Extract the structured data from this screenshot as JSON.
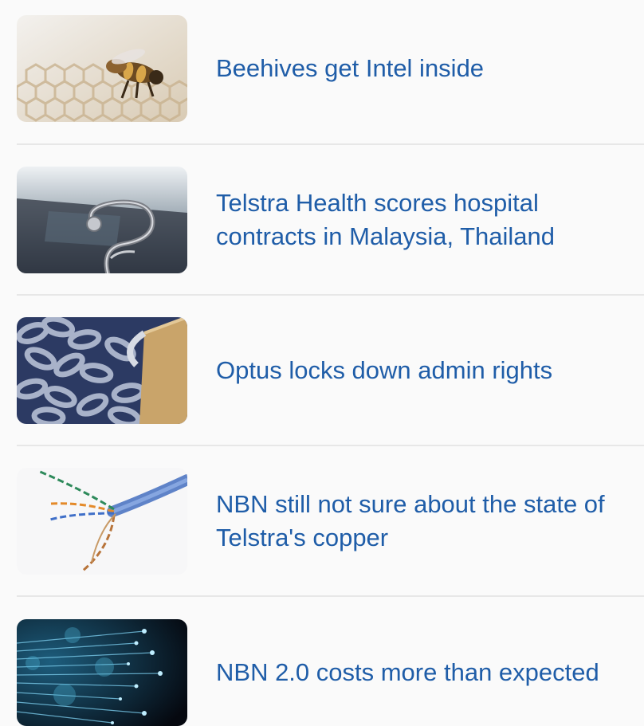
{
  "articles": [
    {
      "title": "Beehives get Intel inside",
      "thumb_icon": "bee-on-honeycomb-image"
    },
    {
      "title": "Telstra Health scores hospital contracts in Malaysia, Thailand",
      "thumb_icon": "stethoscope-image"
    },
    {
      "title": "Optus locks down admin rights",
      "thumb_icon": "chain-and-padlock-image"
    },
    {
      "title": "NBN still not sure about the state of Telstra's copper",
      "thumb_icon": "copper-cable-image"
    },
    {
      "title": "NBN 2.0 costs more than expected",
      "thumb_icon": "fibre-optic-image"
    }
  ],
  "colors": {
    "link": "#1f5da8",
    "divider": "#e7e7e7",
    "background": "#fafafa"
  }
}
